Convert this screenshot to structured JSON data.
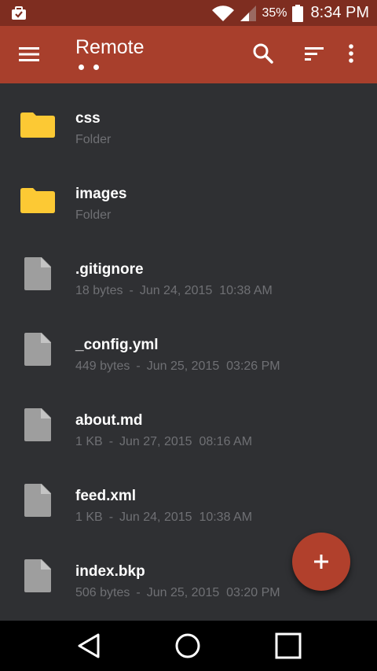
{
  "status_bar": {
    "battery_percent": "35%",
    "time": "8:34 PM",
    "icons": [
      "briefcase-check-icon",
      "wifi-icon",
      "signal-icon",
      "battery-icon"
    ]
  },
  "toolbar": {
    "title": "Remote",
    "page_indicator": {
      "pages": 2
    },
    "icons": [
      "menu-icon",
      "search-icon",
      "sort-icon",
      "more-vert-icon"
    ]
  },
  "files": [
    {
      "name": "css",
      "type": "folder",
      "size": "Folder",
      "date": "",
      "time": ""
    },
    {
      "name": "images",
      "type": "folder",
      "size": "Folder",
      "date": "",
      "time": ""
    },
    {
      "name": ".gitignore",
      "type": "file",
      "size": "18 bytes",
      "date": "Jun 24, 2015",
      "time": "10:38 AM"
    },
    {
      "name": "_config.yml",
      "type": "file",
      "size": "449 bytes",
      "date": "Jun 25, 2015",
      "time": "03:26 PM"
    },
    {
      "name": "about.md",
      "type": "file",
      "size": "1 KB",
      "date": "Jun 27, 2015",
      "time": "08:16 AM"
    },
    {
      "name": "feed.xml",
      "type": "file",
      "size": "1 KB",
      "date": "Jun 24, 2015",
      "time": "10:38 AM"
    },
    {
      "name": "index.bkp",
      "type": "file",
      "size": "506 bytes",
      "date": "Jun 25, 2015",
      "time": "03:20 PM"
    }
  ],
  "fab": {
    "icon": "add-icon"
  },
  "nav_bar": {
    "icons": [
      "back-icon",
      "home-icon",
      "recents-icon"
    ]
  },
  "colors": {
    "status_bar": "#7e2d20",
    "toolbar": "#a83f2c",
    "background": "#2f3033",
    "folder": "#fcc934",
    "file_icon": "#9e9e9e",
    "fab": "#b1402c"
  }
}
